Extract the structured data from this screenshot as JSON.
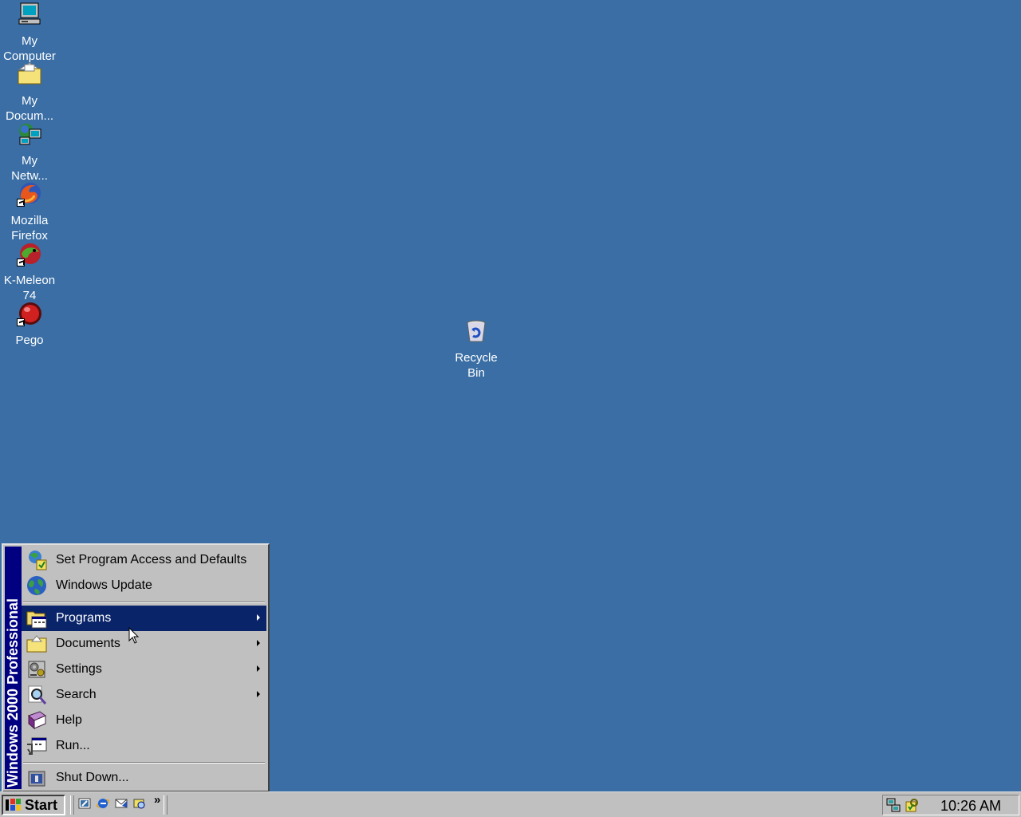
{
  "desktop": {
    "background_color": "#3a6ea5",
    "icons": [
      {
        "label_line1": "My",
        "label_line2": "Computer",
        "icon": "computer-icon"
      },
      {
        "label_line1": "My",
        "label_line2": "Docum...",
        "icon": "documents-folder-icon"
      },
      {
        "label_line1": "My",
        "label_line2": "Netw...",
        "icon": "network-places-icon"
      },
      {
        "label_line1": "Mozilla",
        "label_line2": "Firefox",
        "icon": "firefox-icon"
      },
      {
        "label_line1": "K-Meleon",
        "label_line2": "74",
        "icon": "k-meleon-icon"
      },
      {
        "label_line1": "Pego",
        "label_line2": "",
        "icon": "pego-icon"
      },
      {
        "label_line1": "Recycle",
        "label_line2": "Bin",
        "icon": "recycle-bin-icon"
      }
    ]
  },
  "start_menu": {
    "banner": "Windows 2000 Professional",
    "items": [
      {
        "label": "Set Program Access and Defaults",
        "icon": "program-access-icon",
        "submenu": false
      },
      {
        "label": "Windows Update",
        "icon": "windows-update-icon",
        "submenu": false
      },
      {
        "label": "Programs",
        "icon": "programs-icon",
        "submenu": true,
        "selected": true
      },
      {
        "label": "Documents",
        "icon": "documents-icon",
        "submenu": true
      },
      {
        "label": "Settings",
        "icon": "settings-icon",
        "submenu": true
      },
      {
        "label": "Search",
        "icon": "search-icon",
        "submenu": true
      },
      {
        "label": "Help",
        "icon": "help-icon",
        "submenu": false
      },
      {
        "label": "Run...",
        "icon": "run-icon",
        "submenu": false
      },
      {
        "label": "Shut Down...",
        "icon": "shut-down-icon",
        "submenu": false
      }
    ],
    "selection_color": "#0a246a"
  },
  "taskbar": {
    "start_label": "Start",
    "quick_launch": [
      "show-desktop-icon",
      "internet-explorer-icon",
      "outlook-express-icon",
      "media-icon"
    ],
    "chevron": "»",
    "clock": "10:26 AM",
    "tray_icons": [
      "network-tray-icon",
      "security-tray-icon"
    ]
  }
}
